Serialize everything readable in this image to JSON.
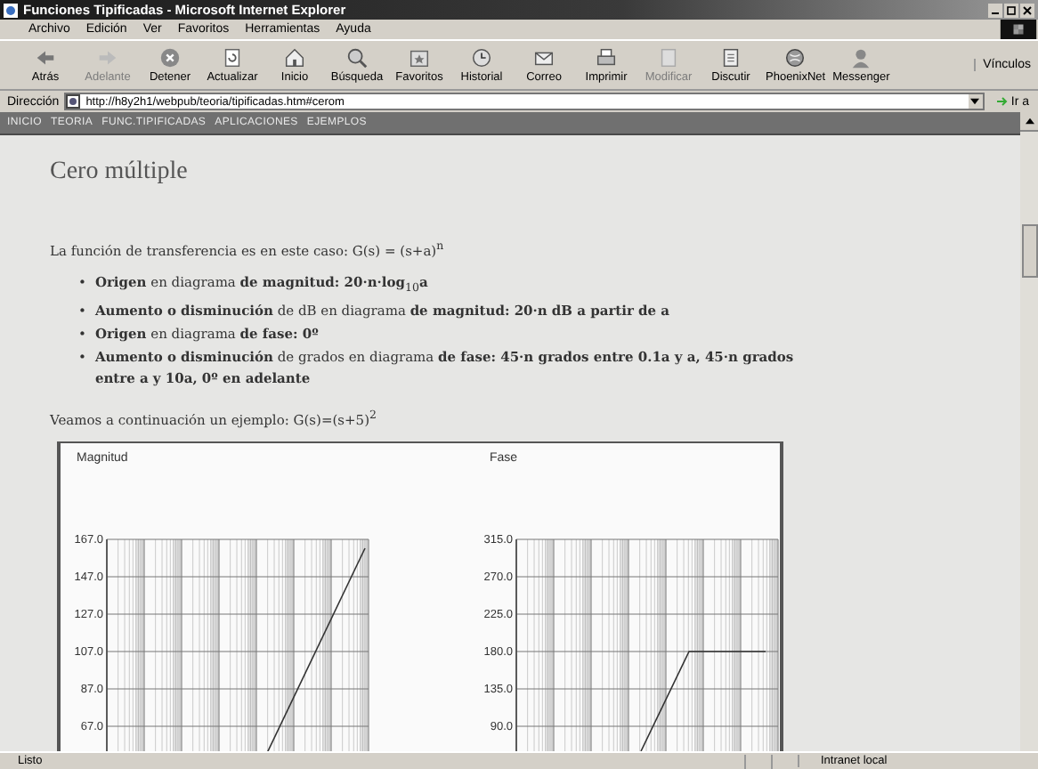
{
  "window": {
    "title": "Funciones Tipificadas - Microsoft Internet Explorer"
  },
  "menu": [
    "Archivo",
    "Edición",
    "Ver",
    "Favoritos",
    "Herramientas",
    "Ayuda"
  ],
  "toolbar": [
    {
      "label": "Atrás",
      "disabled": false
    },
    {
      "label": "Adelante",
      "disabled": true
    },
    {
      "label": "Detener",
      "disabled": false
    },
    {
      "label": "Actualizar",
      "disabled": false
    },
    {
      "label": "Inicio",
      "disabled": false
    },
    {
      "label": "Búsqueda",
      "disabled": false
    },
    {
      "label": "Favoritos",
      "disabled": false
    },
    {
      "label": "Historial",
      "disabled": false
    },
    {
      "label": "Correo",
      "disabled": false
    },
    {
      "label": "Imprimir",
      "disabled": false
    },
    {
      "label": "Modificar",
      "disabled": true
    },
    {
      "label": "Discutir",
      "disabled": false
    },
    {
      "label": "PhoenixNet",
      "disabled": false
    },
    {
      "label": "Messenger",
      "disabled": false
    }
  ],
  "links_label": "Vínculos",
  "address": {
    "label": "Dirección",
    "value": "http://h8y2h1/webpub/teoria/tipificadas.htm#cerom",
    "go": "Ir a"
  },
  "site_nav": [
    "INICIO",
    "TEORIA",
    "FUNC.TIPIFICADAS",
    "APLICACIONES",
    "EJEMPLOS"
  ],
  "heading": "Cero múltiple",
  "intro": "La función de transferencia es en este caso: G(s) = (s+a)$^{n}$",
  "bullets": [
    {
      "marker": "•",
      "text": "**Origen** en diagrama **de magnitud: 20·n·log**$_{10}$**a**"
    },
    {
      "marker": "•",
      "text": "**Aumento o disminución** de dB en diagrama **de magnitud: 20·n dB a partir de a**"
    },
    {
      "marker": "•",
      "text": "**Origen** en diagrama **de fase: 0º**"
    },
    {
      "marker": "•",
      "text": "**Aumento o disminución** de grados en diagrama **de fase: 45·n grados entre 0.1a y a, 45·n grados entre a y 10a, 0º en adelante**"
    }
  ],
  "example": "Veamos a continuación un ejemplo: G(s)=(s+5)$^{2}$",
  "charts": [
    {
      "title": "Magnitud",
      "y_labels": [
        "167.0",
        "147.0",
        "127.0",
        "107.0",
        "87.0",
        "67.0"
      ]
    },
    {
      "title": "Fase",
      "y_labels": [
        "315.0",
        "270.0",
        "225.0",
        "180.0",
        "135.0",
        "90.0"
      ]
    }
  ],
  "status_bar": {
    "text": "Listo",
    "zone": "Intranet local"
  }
}
